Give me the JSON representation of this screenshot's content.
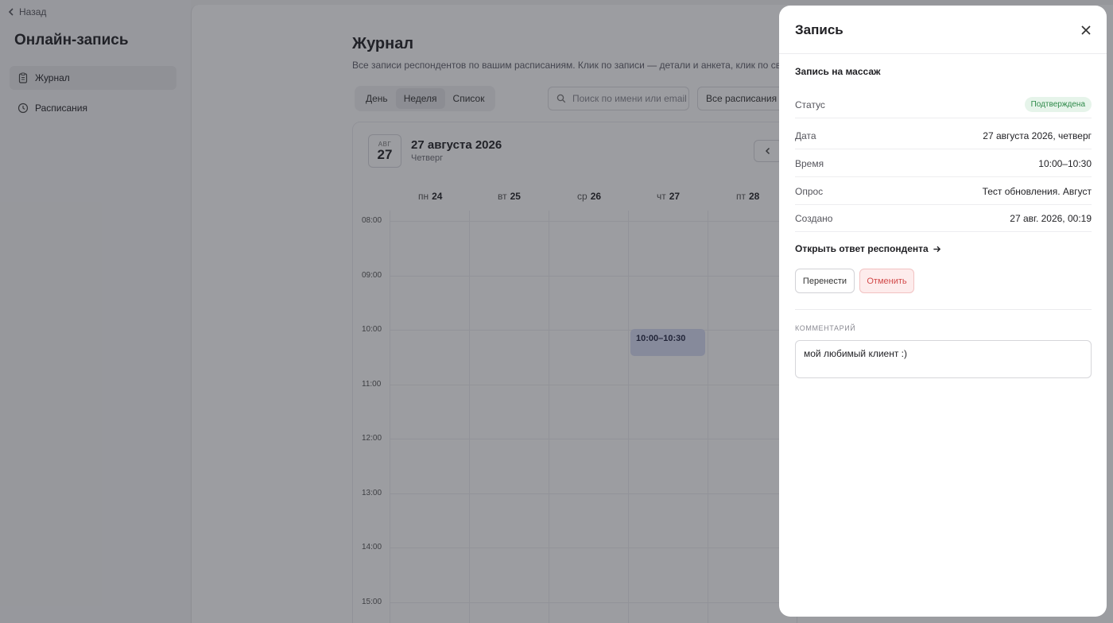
{
  "nav": {
    "back_label": "Назад",
    "app_title": "Онлайн-запись",
    "items": [
      {
        "label": "Журнал",
        "icon": "clipboard-icon",
        "active": true
      },
      {
        "label": "Расписания",
        "icon": "clock-icon",
        "active": false
      }
    ]
  },
  "journal": {
    "title": "Журнал",
    "subtitle": "Все записи респондентов по вашим расписаниям. Клик по записи — детали и анкета, клик по свобо",
    "tabs": [
      {
        "label": "День",
        "active": false
      },
      {
        "label": "Неделя",
        "active": true
      },
      {
        "label": "Список",
        "active": false
      }
    ],
    "search_placeholder": "Поиск по имени или email",
    "filter_label": "Все расписания"
  },
  "calendar": {
    "badge_month": "АВГ",
    "badge_day": "27",
    "date_title": "27 августа 2026",
    "weekday": "Четверг",
    "days": [
      {
        "dow": "пн",
        "num": "24"
      },
      {
        "dow": "вт",
        "num": "25"
      },
      {
        "dow": "ср",
        "num": "26"
      },
      {
        "dow": "чт",
        "num": "27"
      },
      {
        "dow": "пт",
        "num": "28"
      }
    ],
    "hours": [
      "08:00",
      "09:00",
      "10:00",
      "11:00",
      "12:00",
      "13:00",
      "14:00",
      "15:00"
    ],
    "event_label": "10:00–10:30"
  },
  "drawer": {
    "title": "Запись",
    "booking_name": "Запись на массаж",
    "fields": [
      {
        "key": "Статус",
        "value": "Подтверждена"
      },
      {
        "key": "Дата",
        "value": "27 августа 2026, четверг"
      },
      {
        "key": "Время",
        "value": "10:00–10:30"
      },
      {
        "key": "Опрос",
        "value": "Тест обновления. Август"
      },
      {
        "key": "Создано",
        "value": "27 авг. 2026, 00:19"
      }
    ],
    "open_response_link": "Открыть ответ респондента",
    "move_button": "Перенести",
    "cancel_button": "Отменить",
    "comment_label": "КОММЕНТАРИЙ",
    "comment_text": "мой любимый клиент :)"
  },
  "colors": {
    "status_bg": "#e6f4ea",
    "status_text": "#2f8a4a",
    "cancel_text": "#d24a4a",
    "event_bg": "#d7dcf4"
  }
}
